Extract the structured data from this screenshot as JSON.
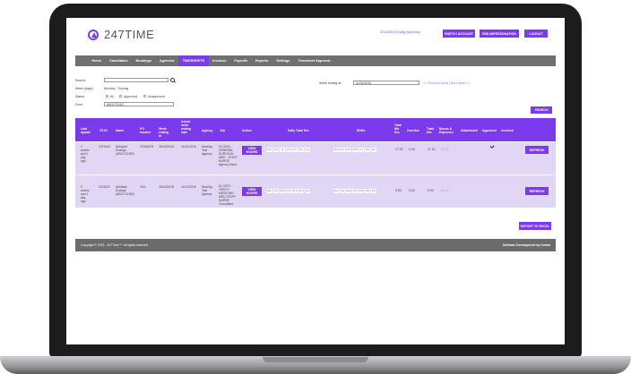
{
  "header": {
    "logo_text": "247TIME",
    "user_text": "ST12345 (S Kelly) (test mss)",
    "switch_account": "SWITCH ACCOUNT",
    "end_impersonation": "END IMPERSONATION",
    "logout": "LOGOUT"
  },
  "nav": {
    "items": [
      "Home",
      "Candidates",
      "Bookings",
      "Agencies",
      "TIMESHEETS",
      "Invoices",
      "Payrolls",
      "Reports",
      "Settings",
      "Timesheet Approval"
    ],
    "active": "TIMESHEETS"
  },
  "filters": {
    "search_label": "Search:",
    "week_label": "Week (days):",
    "week_value": "Monday - Sunday",
    "status_label": "Status:",
    "status_options": [
      "All",
      "Approved",
      "Unapproved"
    ],
    "from_label": "From:",
    "from_value": "AB/17/11/62",
    "week_ending_label": "Week ending at:",
    "week_ending_value": "11/01/2015",
    "pager": "<< Previous week | Next week >>",
    "search_button": "SEARCH"
  },
  "table": {
    "headers": {
      "last_update": "Last update",
      "ts_id": "TS ID",
      "name": "Name",
      "po_number": "PO number",
      "week_ending": "Week ending at",
      "actual_week": "Actual week ending date",
      "agency": "Agency",
      "job": "Job",
      "action": "Action",
      "daily_total": "Daily Total Hrs",
      "shifts": "Shifts",
      "total_nis": "Total NIs Hrs",
      "overdue": "Overdue",
      "total_hrs": "Total Hrs",
      "bonus": "Bonus & Expenses",
      "attachment": "Attachment",
      "approved": "Approved",
      "invoiced": "Invoiced"
    },
    "days": [
      "Mon",
      "Tue",
      "Wed",
      "Thu",
      "Fri",
      "Sat",
      "Sun"
    ],
    "rows": [
      {
        "last_update": "2 weeks and 1 day ago",
        "ts_id": "2374412",
        "name": "Abhilash Rodrigo (AB/17/11/62)",
        "po_number": "12345678",
        "week_ending": "25/01/2015",
        "actual_week": "11/01/2015",
        "agency": "Nursing Test Agency",
        "job": "0) 10412 - GENERAL SURGICAL MED - STAFF NURSE Agency Band",
        "action": "VIEW HOURS",
        "daily": [
          "Mon",
          "Tue",
          "11",
          "10.2",
          "Fri",
          "Sat",
          "Sun"
        ],
        "shifts": [
          "Mon",
          "Tue",
          "9.40",
          "8.60",
          "Fri",
          "Sat",
          "Sun"
        ],
        "total_nis": "17.23",
        "overdue": "0.00",
        "total_hrs": "17.23",
        "bonus": "£0.00",
        "approved": true,
        "refresh": "REFRESH"
      },
      {
        "last_update": "2 weeks and 1 day ago",
        "ts_id": "2322037",
        "name": "Abhilash Rodrigo (AB/17/11/62)",
        "po_number": "1111",
        "week_ending": "25/01/2015",
        "actual_week": "11/01/2015",
        "agency": "Nursing Test Agency",
        "job": "0) 12071 - OKEDY MEDICINE MED STAFF NURSE Consultant",
        "action": "VIEW HOURS",
        "daily": [
          "Mon",
          "Tue",
          "Wed",
          "Thu",
          "11.2",
          "11.2",
          "11.2"
        ],
        "shifts": [
          "Mon",
          "Tue",
          "Wed",
          "Thu",
          "8.00",
          "Sat",
          "Sun"
        ],
        "total_nis": "5.00",
        "overdue": "0.00",
        "total_hrs": "5.00",
        "bonus": "£0.00",
        "approved": false,
        "refresh": "REFRESH"
      }
    ]
  },
  "export_button": "EXPORT TO EXCEL",
  "footer": {
    "copyright": "Copyright © 2015 - 247Time™. All rights reserved.",
    "credit": "Software Development by Dudoo"
  },
  "colors": {
    "accent": "#7c3aed",
    "nav": "#707070",
    "row": "#e2d6f5",
    "footer": "#6b6b6b"
  }
}
